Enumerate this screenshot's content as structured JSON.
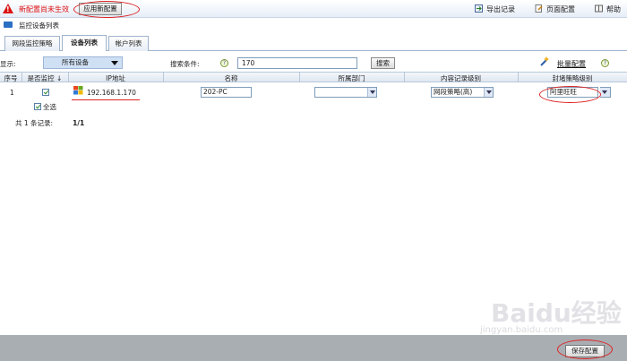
{
  "topbar": {
    "warning": "新配置尚未生效",
    "apply_button": "应用新配置",
    "tools": {
      "export": "导出记录",
      "page_config": "页面配置",
      "help": "帮助"
    }
  },
  "breadcrumb": "监控设备列表",
  "tabs": [
    {
      "label": "网段监控策略",
      "active": false
    },
    {
      "label": "设备列表",
      "active": true
    },
    {
      "label": "帐户列表",
      "active": false
    }
  ],
  "filter": {
    "display_label": "显示:",
    "display_value": "所有设备",
    "search_label": "搜索条件:",
    "search_value": "170",
    "search_button": "搜索",
    "batch_config": "批量配置"
  },
  "table": {
    "headers": [
      "序号",
      "是否监控 ↓",
      "IP地址",
      "名称",
      "所属部门",
      "内容记录级别",
      "封堵策略级别"
    ],
    "rows": [
      {
        "index": "1",
        "monitored": true,
        "ip": "192.168.1.170",
        "name": "202-PC",
        "department": "",
        "record_level": "网段策略(高)",
        "block_level": "阿里旺旺"
      }
    ],
    "select_all": "全选",
    "total": "共 1 条记录:",
    "page": "1/1"
  },
  "footer": {
    "save_button": "保存配置"
  },
  "watermark": {
    "logo": "Baidu经验",
    "site": "jingyan.baidu.com"
  },
  "colors": {
    "warning": "#dd1111",
    "highlight": "#dd2222",
    "footer": "#a9aeb3",
    "select_bg": "#cfe0f4"
  }
}
